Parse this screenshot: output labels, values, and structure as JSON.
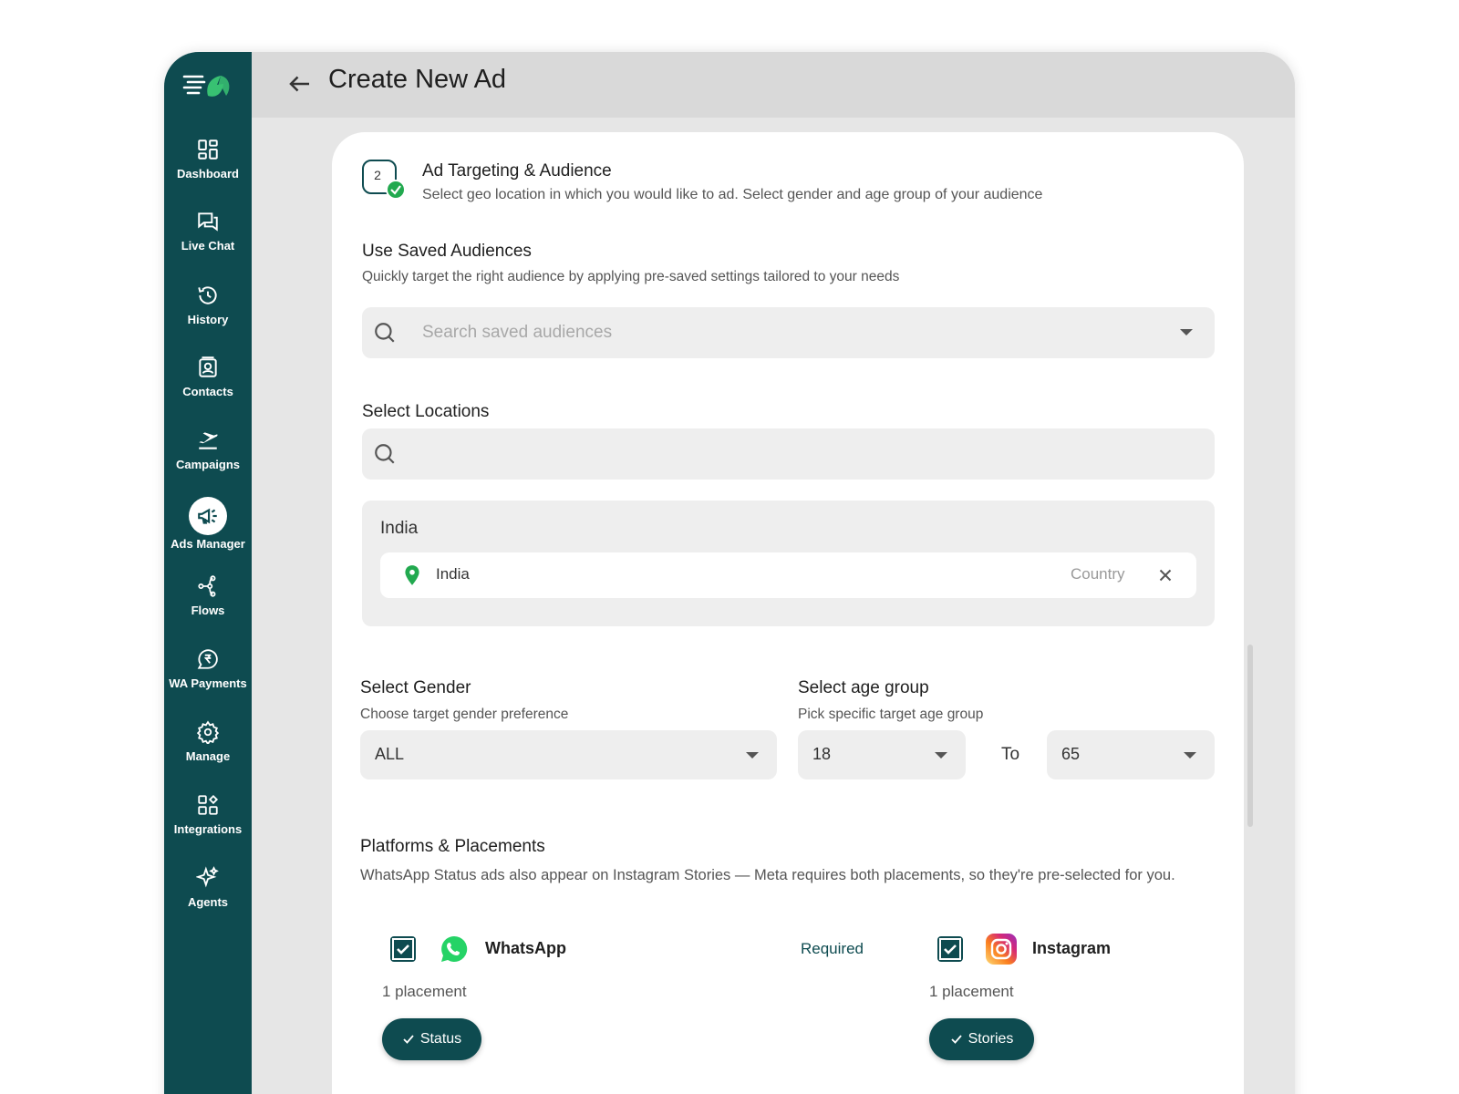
{
  "header": {
    "title": "Create New Ad"
  },
  "sidebar": {
    "items": [
      {
        "label": "Dashboard",
        "icon": "dashboard-icon"
      },
      {
        "label": "Live Chat",
        "icon": "chat-icon"
      },
      {
        "label": "History",
        "icon": "history-icon"
      },
      {
        "label": "Contacts",
        "icon": "contacts-icon"
      },
      {
        "label": "Campaigns",
        "icon": "campaigns-icon"
      },
      {
        "label": "Ads Manager",
        "icon": "megaphone-icon",
        "active": true
      },
      {
        "label": "Flows",
        "icon": "flows-icon"
      },
      {
        "label": "WA Payments",
        "icon": "rupee-icon"
      },
      {
        "label": "Manage",
        "icon": "gear-icon"
      },
      {
        "label": "Integrations",
        "icon": "integrations-icon"
      },
      {
        "label": "Agents",
        "icon": "sparkle-icon"
      }
    ]
  },
  "step": {
    "number": "2",
    "title": "Ad Targeting & Audience",
    "subtitle": "Select geo location in which you would like to ad. Select gender and age group of your audience"
  },
  "saved_audiences": {
    "title": "Use Saved Audiences",
    "subtitle": "Quickly target the right audience by applying pre-saved settings tailored to your needs",
    "placeholder": "Search saved audiences"
  },
  "locations": {
    "title": "Select Locations",
    "search_placeholder": "",
    "group": "India",
    "items": [
      {
        "name": "India",
        "type": "Country"
      }
    ]
  },
  "gender": {
    "title": "Select Gender",
    "subtitle": "Choose target gender preference",
    "value": "ALL"
  },
  "age": {
    "title": "Select age group",
    "subtitle": "Pick specific target age group",
    "from": "18",
    "to_label": "To",
    "to": "65"
  },
  "platforms": {
    "title": "Platforms & Placements",
    "subtitle": "WhatsApp Status ads also appear on Instagram Stories — Meta requires both placements, so they're pre-selected for you.",
    "required_label": "Required",
    "items": [
      {
        "name": "WhatsApp",
        "checked": true,
        "placement_count": "1 placement",
        "placement": "Status"
      },
      {
        "name": "Instagram",
        "checked": true,
        "placement_count": "1 placement",
        "placement": "Stories"
      }
    ]
  },
  "colors": {
    "brand": "#0e4b50",
    "whatsapp": "#25d366",
    "check_green": "#22a94f"
  }
}
